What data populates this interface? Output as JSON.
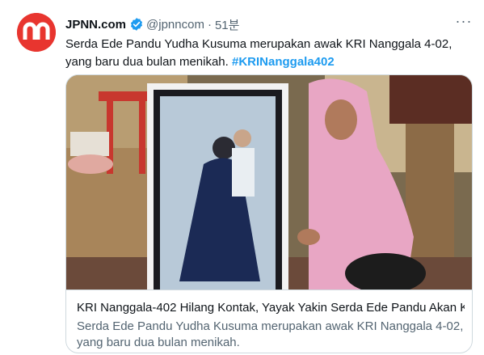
{
  "tweet": {
    "author_name": "JPNN.com",
    "handle": "@jpnncom",
    "separator": "·",
    "time": "51분",
    "more_label": "···",
    "text": "Serda Ede Pandu Yudha Kusuma merupakan awak KRI Nanggala 4-02, yang baru dua bulan menikah.",
    "hashtag": "#KRINanggala402",
    "icons": {
      "avatar": "jpnn-logo",
      "verified": "verified-badge-icon",
      "more": "more-icon"
    },
    "colors": {
      "brand": "#e8352f",
      "link": "#1d9bf0",
      "verified": "#1d9bf0",
      "secondary_text": "#536471"
    }
  },
  "card": {
    "title": "KRI Nanggala-402 Hilang Kontak, Yayak Yakin Serda Ede Pandu Akan K...",
    "description": "Serda Ede Pandu Yudha Kusuma merupakan awak KRI Nanggala 4-02, yang baru dua bulan menikah."
  }
}
